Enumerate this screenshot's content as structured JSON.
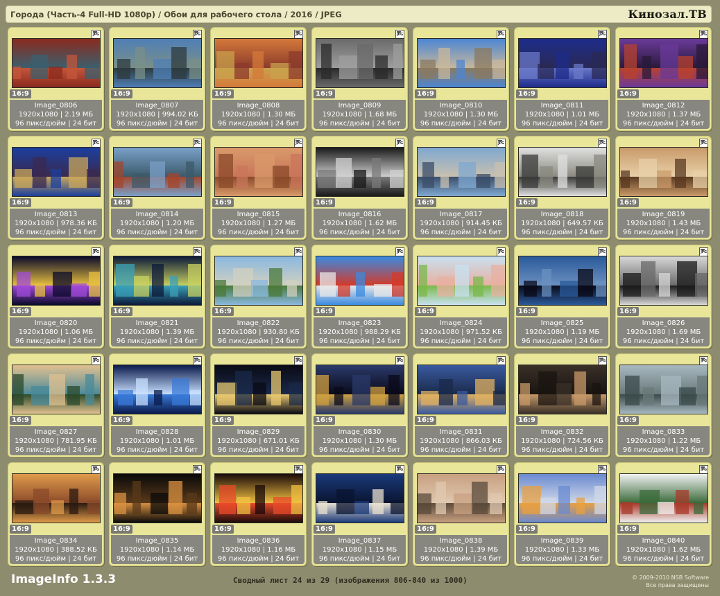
{
  "header": {
    "title": "Города (Часть-4 Full-HD 1080p) / Обои для рабочего стола / 2016 / JPEG",
    "brand": "Кинозал.ТВ"
  },
  "file_type_label": "JPG",
  "images": [
    {
      "name": "Image_0806",
      "ratio": "16:9",
      "size": "1920x1080 | 2.19 МБ",
      "meta": "96 пикс/дюйм | 24 бит",
      "palette": [
        "#8a2b1f",
        "#c4553a",
        "#3a5f6e"
      ]
    },
    {
      "name": "Image_0807",
      "ratio": "16:9",
      "size": "1920x1080 | 994.02 КБ",
      "meta": "96 пикс/дюйм | 24 бит",
      "palette": [
        "#4f7fb6",
        "#2d3b3f",
        "#7a8f88"
      ]
    },
    {
      "name": "Image_0808",
      "ratio": "16:9",
      "size": "1920x1080 | 1.30 МБ",
      "meta": "96 пикс/дюйм | 24 бит",
      "palette": [
        "#d4793a",
        "#c9a24c",
        "#8c3b2c"
      ]
    },
    {
      "name": "Image_0809",
      "ratio": "16:9",
      "size": "1920x1080 | 1.68 МБ",
      "meta": "96 пикс/дюйм | 24 бит",
      "palette": [
        "#6a6a6a",
        "#2b2b2b",
        "#9e9e9e"
      ]
    },
    {
      "name": "Image_0810",
      "ratio": "16:9",
      "size": "1920x1080 | 1.30 МБ",
      "meta": "96 пикс/дюйм | 24 бит",
      "palette": [
        "#4c86d4",
        "#8a7a60",
        "#c7b79c"
      ]
    },
    {
      "name": "Image_0811",
      "ratio": "16:9",
      "size": "1920x1080 | 1.01 МБ",
      "meta": "96 пикс/дюйм | 24 бит",
      "palette": [
        "#1d2c8a",
        "#6a78c8",
        "#2a2a55"
      ]
    },
    {
      "name": "Image_0812",
      "ratio": "16:9",
      "size": "1920x1080 | 1.37 МБ",
      "meta": "96 пикс/дюйм | 24 бит",
      "palette": [
        "#6a3a9a",
        "#b8412f",
        "#2a1a3a"
      ]
    },
    {
      "name": "Image_0813",
      "ratio": "16:9",
      "size": "1920x1080 | 978.36 КБ",
      "meta": "96 пикс/дюйм | 24 бит",
      "palette": [
        "#1c3f9e",
        "#c9a75a",
        "#3a2a50"
      ]
    },
    {
      "name": "Image_0814",
      "ratio": "16:9",
      "size": "1920x1080 | 1.20 МБ",
      "meta": "96 пикс/дюйм | 24 бит",
      "palette": [
        "#7aa0c8",
        "#a3462d",
        "#3c5a6a"
      ]
    },
    {
      "name": "Image_0815",
      "ratio": "16:9",
      "size": "1920x1080 | 1.27 МБ",
      "meta": "96 пикс/дюйм | 24 бит",
      "palette": [
        "#d99a6a",
        "#8a4a2a",
        "#c9765a"
      ]
    },
    {
      "name": "Image_0816",
      "ratio": "16:9",
      "size": "1920x1080 | 1.62 МБ",
      "meta": "96 пикс/дюйм | 24 бит",
      "palette": [
        "#1a1a1a",
        "#7a7a7a",
        "#d0d0d0"
      ]
    },
    {
      "name": "Image_0817",
      "ratio": "16:9",
      "size": "1920x1080 | 914.45 КБ",
      "meta": "96 пикс/дюйм | 24 бит",
      "palette": [
        "#7fa8d0",
        "#3b4e6a",
        "#c8c0b0"
      ]
    },
    {
      "name": "Image_0818",
      "ratio": "16:9",
      "size": "1920x1080 | 649.57 КБ",
      "meta": "96 пикс/дюйм | 24 бит",
      "palette": [
        "#e0e0e0",
        "#3a3a38",
        "#8a8a80"
      ]
    },
    {
      "name": "Image_0819",
      "ratio": "16:9",
      "size": "1920x1080 | 1.43 МБ",
      "meta": "96 пикс/дюйм | 24 бит",
      "palette": [
        "#c99a6a",
        "#5a3a22",
        "#e8d0a8"
      ]
    },
    {
      "name": "Image_0820",
      "ratio": "16:9",
      "size": "1920x1080 | 1.06 МБ",
      "meta": "96 пикс/дюйм | 24 бит",
      "palette": [
        "#0a0a2a",
        "#a04ad8",
        "#e8c040"
      ]
    },
    {
      "name": "Image_0821",
      "ratio": "16:9",
      "size": "1920x1080 | 1.39 МБ",
      "meta": "96 пикс/дюйм | 24 бит",
      "palette": [
        "#0c1a3a",
        "#3aa0b8",
        "#c8d060"
      ]
    },
    {
      "name": "Image_0822",
      "ratio": "16:9",
      "size": "1920x1080 | 930.80 КБ",
      "meta": "96 пикс/дюйм | 24 бит",
      "palette": [
        "#8ab8e0",
        "#4a7a3a",
        "#d0d0c0"
      ]
    },
    {
      "name": "Image_0823",
      "ratio": "16:9",
      "size": "1920x1080 | 988.29 КБ",
      "meta": "96 пикс/дюйм | 24 бит",
      "palette": [
        "#3a8ae0",
        "#e8e8e8",
        "#d43a2a"
      ]
    },
    {
      "name": "Image_0824",
      "ratio": "16:9",
      "size": "1920x1080 | 971.52 КБ",
      "meta": "96 пикс/дюйм | 24 бит",
      "palette": [
        "#c8e0f0",
        "#7ab84a",
        "#e8b0a0"
      ]
    },
    {
      "name": "Image_0825",
      "ratio": "16:9",
      "size": "1920x1080 | 1.19 МБ",
      "meta": "96 пикс/дюйм | 24 бит",
      "palette": [
        "#2a5a9a",
        "#0a0a18",
        "#6a90c0"
      ]
    },
    {
      "name": "Image_0826",
      "ratio": "16:9",
      "size": "1920x1080 | 1.69 МБ",
      "meta": "96 пикс/дюйм | 24 бит",
      "palette": [
        "#d8d8d8",
        "#1a1a1a",
        "#6a6a6a"
      ]
    },
    {
      "name": "Image_0827",
      "ratio": "16:9",
      "size": "1920x1080 | 781.95 КБ",
      "meta": "96 пикс/дюйм | 24 бит",
      "palette": [
        "#e0c090",
        "#2a4a2a",
        "#4a8a9a"
      ]
    },
    {
      "name": "Image_0828",
      "ratio": "16:9",
      "size": "1920x1080 | 1.01 МБ",
      "meta": "96 пикс/дюйм | 24 бит",
      "palette": [
        "#0a1a4a",
        "#3a7ad8",
        "#c8e0ff"
      ]
    },
    {
      "name": "Image_0829",
      "ratio": "16:9",
      "size": "1920x1080 | 671.01 КБ",
      "meta": "96 пикс/дюйм | 24 бит",
      "palette": [
        "#0a0a14",
        "#e8c870",
        "#1a2a4a"
      ]
    },
    {
      "name": "Image_0830",
      "ratio": "16:9",
      "size": "1920x1080 | 1.30 МБ",
      "meta": "96 пикс/дюйм | 24 бит",
      "palette": [
        "#2a3a6a",
        "#d0a040",
        "#0a0a1a"
      ]
    },
    {
      "name": "Image_0831",
      "ratio": "16:9",
      "size": "1920x1080 | 866.03 КБ",
      "meta": "96 пикс/дюйм | 24 бит",
      "palette": [
        "#3a5aa0",
        "#e0b060",
        "#1a2a4a"
      ]
    },
    {
      "name": "Image_0832",
      "ratio": "16:9",
      "size": "1920x1080 | 724.56 КБ",
      "meta": "96 пикс/дюйм | 24 бит",
      "palette": [
        "#3a3028",
        "#c89a6a",
        "#1a1410"
      ]
    },
    {
      "name": "Image_0833",
      "ratio": "16:9",
      "size": "1920x1080 | 1.22 МБ",
      "meta": "96 пикс/дюйм | 24 бит",
      "palette": [
        "#a8b8c0",
        "#3a4a4a",
        "#6a7a7a"
      ]
    },
    {
      "name": "Image_0834",
      "ratio": "16:9",
      "size": "1920x1080 | 388.52 КБ",
      "meta": "96 пикс/дюйм | 24 бит",
      "palette": [
        "#e09a4a",
        "#2a1a10",
        "#8a4a2a"
      ]
    },
    {
      "name": "Image_0835",
      "ratio": "16:9",
      "size": "1920x1080 | 1.14 МБ",
      "meta": "96 пикс/дюйм | 24 бит",
      "palette": [
        "#0a0a0a",
        "#d89040",
        "#5a3a1a"
      ]
    },
    {
      "name": "Image_0836",
      "ratio": "16:9",
      "size": "1920x1080 | 1.16 МБ",
      "meta": "96 пикс/дюйм | 24 бит",
      "palette": [
        "#1a0a0a",
        "#e84a2a",
        "#f0c040"
      ]
    },
    {
      "name": "Image_0837",
      "ratio": "16:9",
      "size": "1920x1080 | 1.15 МБ",
      "meta": "96 пикс/дюйм | 24 бит",
      "palette": [
        "#1a3a7a",
        "#e8e0d0",
        "#0a1430"
      ]
    },
    {
      "name": "Image_0838",
      "ratio": "16:9",
      "size": "1920x1080 | 1.39 МБ",
      "meta": "96 пикс/дюйм | 24 бит",
      "palette": [
        "#c8a080",
        "#5a4a3a",
        "#e0c8b0"
      ]
    },
    {
      "name": "Image_0839",
      "ratio": "16:9",
      "size": "1920x1080 | 1.33 МБ",
      "meta": "96 пикс/дюйм | 24 бит",
      "palette": [
        "#6a8ad0",
        "#e8a040",
        "#d0d8e8"
      ]
    },
    {
      "name": "Image_0840",
      "ratio": "16:9",
      "size": "1920x1080 | 1.62 МБ",
      "meta": "96 пикс/дюйм | 24 бит",
      "palette": [
        "#f0f0f0",
        "#a83a2a",
        "#3a6a3a"
      ]
    }
  ],
  "footer": {
    "app_name": "ImageInfo 1.3.3",
    "summary": "Сводный лист 24 из 29 (изображения 806-840 из 1000)",
    "copyright": "© 2009-2010 NSB Software",
    "rights": "Все права защищены"
  }
}
